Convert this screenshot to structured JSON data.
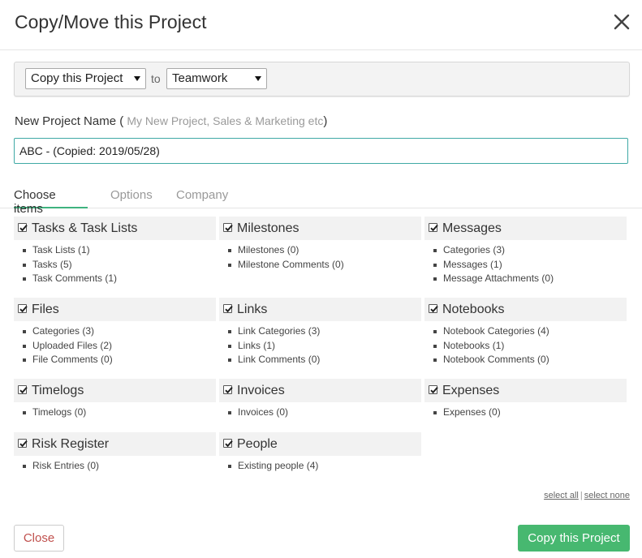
{
  "dialog": {
    "title": "Copy/Move this Project"
  },
  "toolbar": {
    "mode_select": {
      "value": "Copy this Project"
    },
    "to_label": "to",
    "target_select": {
      "value": "Teamwork"
    }
  },
  "name_field": {
    "label": "New Project Name (",
    "hint": "My New Project, Sales & Marketing etc",
    "label_close": ")",
    "value": "ABC - (Copied: 2019/05/28)"
  },
  "tabs": [
    {
      "label": "Choose items",
      "active": true
    },
    {
      "label": "Options",
      "active": false
    },
    {
      "label": "Company",
      "active": false
    }
  ],
  "sections": [
    {
      "title": "Tasks & Task Lists",
      "checked": true,
      "items": [
        "Task Lists (1)",
        "Tasks (5)",
        "Task Comments (1)"
      ]
    },
    {
      "title": "Milestones",
      "checked": true,
      "items": [
        "Milestones (0)",
        "Milestone Comments (0)"
      ]
    },
    {
      "title": "Messages",
      "checked": true,
      "items": [
        "Categories (3)",
        "Messages (1)",
        "Message Attachments (0)"
      ]
    },
    {
      "title": "Files",
      "checked": true,
      "items": [
        "Categories (3)",
        "Uploaded Files (2)",
        "File Comments (0)"
      ]
    },
    {
      "title": "Links",
      "checked": true,
      "items": [
        "Link Categories (3)",
        "Links (1)",
        "Link Comments (0)"
      ]
    },
    {
      "title": "Notebooks",
      "checked": true,
      "items": [
        "Notebook Categories (4)",
        "Notebooks (1)",
        "Notebook Comments (0)"
      ]
    },
    {
      "title": "Timelogs",
      "checked": true,
      "items": [
        "Timelogs (0)"
      ]
    },
    {
      "title": "Invoices",
      "checked": true,
      "items": [
        "Invoices (0)"
      ]
    },
    {
      "title": "Expenses",
      "checked": true,
      "items": [
        "Expenses (0)"
      ]
    },
    {
      "title": "Risk Register",
      "checked": true,
      "items": [
        "Risk Entries (0)"
      ]
    },
    {
      "title": "People",
      "checked": true,
      "items": [
        "Existing people (4)"
      ]
    }
  ],
  "selection_links": {
    "select_all": "select all",
    "separator": "|",
    "select_none": "select none"
  },
  "footer": {
    "close_label": "Close",
    "submit_label": "Copy this Project"
  },
  "colors": {
    "accent_green": "#47b870",
    "tab_underline": "#3fb37f",
    "input_border": "#3fa9a5",
    "close_text": "#c0504d"
  },
  "icons": {
    "close": "close-icon",
    "dropdown": "chevron-down-icon",
    "checkbox": "checkbox-checked-icon"
  }
}
